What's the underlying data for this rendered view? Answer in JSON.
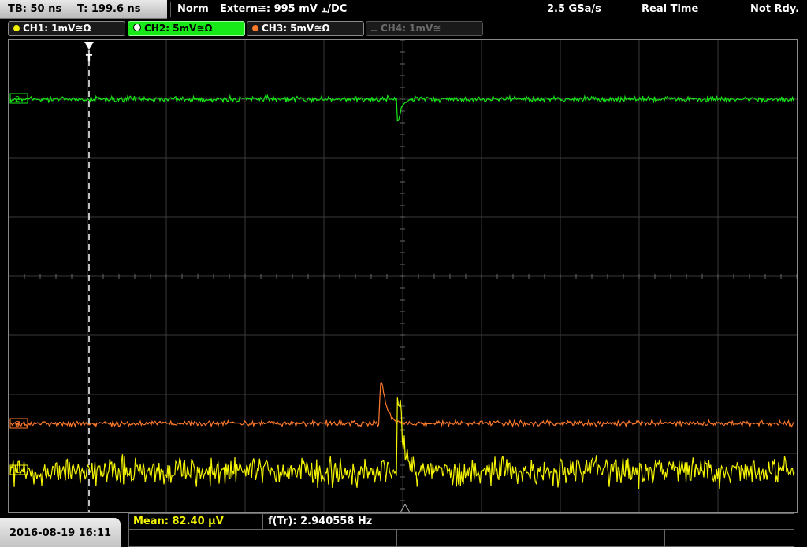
{
  "status": {
    "timebase": "TB: 50 ns",
    "trigger_time": "T: 199.6 ns",
    "mode": "Norm",
    "trigger_source": "Extern≅: 995 mV ⫠/DC",
    "sample_rate": "2.5 GSa/s",
    "acq_mode": "Real Time",
    "state": "Not Rdy."
  },
  "channels": [
    {
      "label": "CH1: 1mV≅Ω",
      "color": "#f5f500",
      "state": "on"
    },
    {
      "label": "CH2: 5mV≅Ω",
      "color": "#17e817",
      "state": "active"
    },
    {
      "label": "CH3: 5mV≅Ω",
      "color": "#ff7a2a",
      "state": "on"
    },
    {
      "label": "CH4: 1mV≅",
      "color": "#6a6a6a",
      "state": "off"
    }
  ],
  "markers": {
    "trigger": "T",
    "ch1": "1",
    "ch2": "2",
    "ch3": "3"
  },
  "colors": {
    "ch1": "#f5f500",
    "ch2": "#17e817",
    "ch3": "#ff7a2a",
    "grid": "#3a3a3a"
  },
  "bottom": {
    "datetime": "2016-08-19 16:11",
    "mean": "Mean: 82.40 µV",
    "freq": "f(Tr): 2.940558 Hz"
  }
}
